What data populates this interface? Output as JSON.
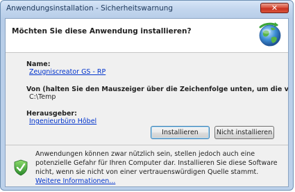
{
  "window": {
    "title": "Anwendungsinstallation - Sicherheitswarnung"
  },
  "header": {
    "question": "Möchten Sie diese Anwendung installieren?",
    "icon": "globe-install-icon"
  },
  "details": {
    "name_label": "Name:",
    "name_value": "Zeugniscreator GS - RP",
    "from_label": "Von (halten Sie den Mauszeiger über die Zeichenfolge unten, um die vollständige Domäne anzuze",
    "from_value": "C:\\Temp",
    "publisher_label": "Herausgeber:",
    "publisher_value": "Ingenieurbüro Hôbel"
  },
  "buttons": {
    "install_label": "Installieren",
    "dont_install_label": "Nicht installieren"
  },
  "footer": {
    "icon": "shield-check-icon",
    "warning_text": "Anwendungen können zwar nützlich sein, stellen jedoch auch eine potenzielle Gefahr für Ihren Computer dar. Installieren Sie diese Software nicht, wenn sie nicht von einer vertrauenswürdigen Quelle stammt. ",
    "more_info_link": "Weitere Informationen..."
  },
  "colors": {
    "link": "#0033cc",
    "title_text": "#1e395b",
    "close_button": "#c7321f",
    "panel_background": "#f0f0f0",
    "shield_green": "#3aa53a"
  }
}
